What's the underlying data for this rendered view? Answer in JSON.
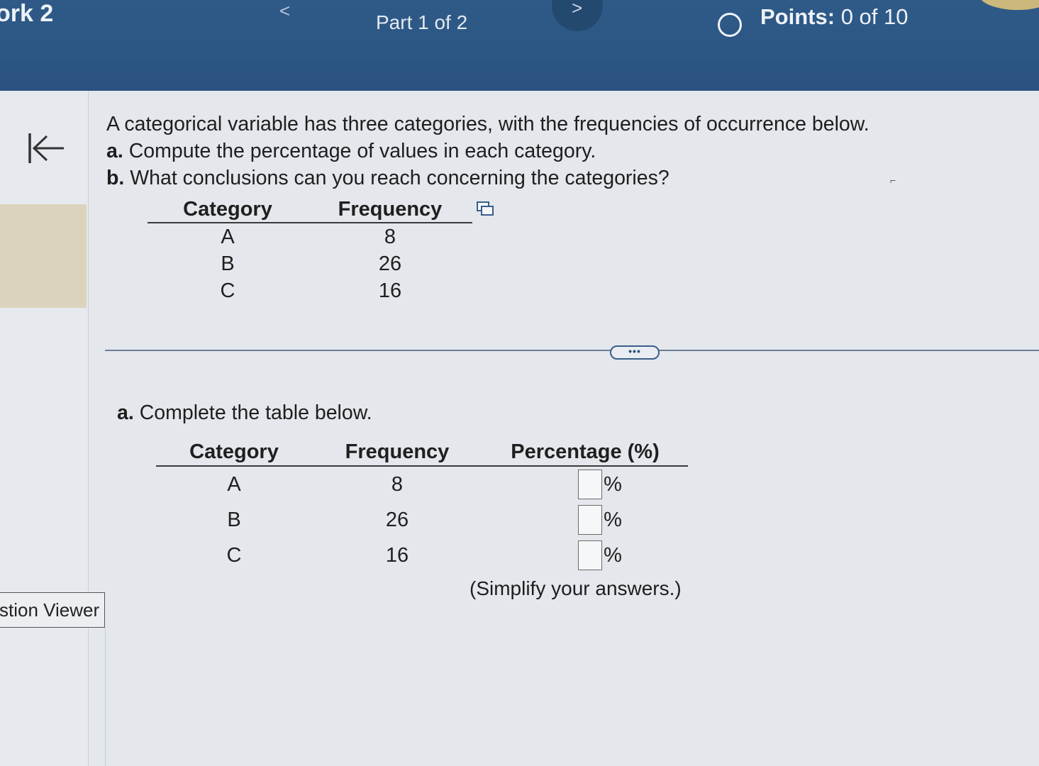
{
  "header": {
    "homework_title": "ork 2",
    "prev_glyph": "<",
    "part_label": "Part 1 of 2",
    "next_glyph": ">",
    "points_label": "Points:",
    "points_value": "0 of 10"
  },
  "sidebar": {
    "question_viewer_label": "stion Viewer"
  },
  "problem": {
    "intro": "A categorical variable has three categories, with the frequencies of occurrence below.",
    "part_a_label": "a.",
    "part_a_text": "Compute the percentage of values in each category.",
    "part_b_label": "b.",
    "part_b_text": "What conclusions can you reach concerning the categories?",
    "table": {
      "headers": [
        "Category",
        "Frequency"
      ],
      "rows": [
        [
          "A",
          "8"
        ],
        [
          "B",
          "26"
        ],
        [
          "C",
          "16"
        ]
      ]
    }
  },
  "answer_section": {
    "label": "a.",
    "instruction": "Complete the table below.",
    "headers": [
      "Category",
      "Frequency",
      "Percentage (%)"
    ],
    "rows": [
      {
        "category": "A",
        "frequency": "8",
        "percent_value": "",
        "unit": "%"
      },
      {
        "category": "B",
        "frequency": "26",
        "percent_value": "",
        "unit": "%"
      },
      {
        "category": "C",
        "frequency": "16",
        "percent_value": "",
        "unit": "%"
      }
    ],
    "note": "(Simplify your answers.)"
  },
  "colors": {
    "header_bg": "#2c5684",
    "page_bg": "#e4e7ec",
    "accent": "#3a5f8a"
  },
  "icons": [
    "collapse-left-icon",
    "copy-data-icon",
    "more-options-icon",
    "points-status-icon"
  ]
}
